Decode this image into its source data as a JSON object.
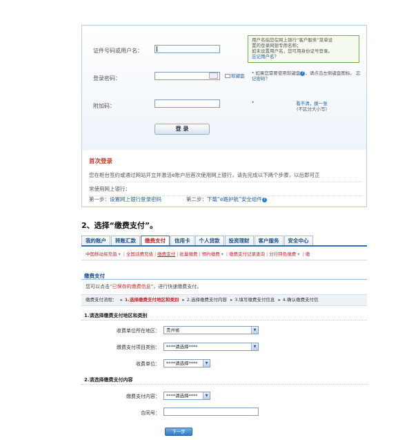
{
  "login": {
    "username_label": "证件号码或用户名：",
    "password_label": "登录密码：",
    "captcha_label": "附加码：",
    "hint_box": {
      "line1": "用户名指您在网上银行“客户服务”菜单设",
      "line2": "置的登录网银专用名称；",
      "line3": "如未设置用户名，您可用身份证号登录。",
      "link": "忘记用户名？"
    },
    "keyboard_icon": "键盘",
    "soft_keyboard_link": "软键盘",
    "soft_keyboard_hint_prefix": "* 如果您需要使用软键盘",
    "soft_keyboard_hint_mid": "，请点击左侧键盘图标。",
    "forgot_password_link": "忘记密码？",
    "captcha_star": "*",
    "captcha_refresh_line1": "看不清，换一张",
    "captcha_refresh_line2": "(不区分大小写)",
    "login_button": "登 录",
    "first_login_title": "首次登录",
    "first_login_desc_line1": "您在柜台签约或通过网站开立并激活e账户后首次使用网上银行，请先完成以下两个步骤，以后即可正",
    "first_login_desc_line2": "常使用网上银行：",
    "step1_prefix": "第一步：",
    "step1_link": "设置网上银行登录密码",
    "step2_prefix": "第二步：",
    "step2_link": "下载“e路护航”安全组件"
  },
  "step2_heading": "2、选择“缴费支付”。",
  "nav": {
    "tabs": [
      "我的账户",
      "转账汇款",
      "缴费支付",
      "信用卡",
      "个人贷款",
      "投资理财",
      "客户服务",
      "安全中心"
    ]
  },
  "subnav": {
    "items": [
      "中国移动易充值",
      "全国话费充值",
      "缴费支付",
      "批量缴费",
      "预约缴费",
      "缴费支付记录查询",
      "分行特色缴费",
      "缴"
    ]
  },
  "pay": {
    "section_title": "缴费支付",
    "intro_prefix": "您可以点击",
    "intro_quote": "“已保存的缴费信息”",
    "intro_suffix": "，进行快速缴费支付。",
    "flow_label": "缴费支付流程：",
    "flow_step1": "1.选择缴费支付地区和类别",
    "flow_step2": "2.选择缴费支付内容",
    "flow_step3": "3.填写缴费支付信息",
    "flow_step4": "4.确认缴费支付信",
    "group1_title": "1.请选择缴费支付地区和类别",
    "region_label": "收费单位所在地区：",
    "region_value": "贵州省",
    "category_label": "缴费支付项目类别：",
    "category_value": "****请选择****",
    "unit_label": "收费单位：",
    "unit_value": "****请选择****",
    "group2_title": "2.请选择缴费支付内容",
    "content_label": "缴费支付内容：",
    "content_value": "****请选择****",
    "contract_label": "合同号：",
    "contract_value": "",
    "next_button": "下一步"
  },
  "colors": {
    "accent_red": "#c62828",
    "nav_blue": "#2d6db5",
    "link_blue": "#1f5fa8",
    "hint_green": "#6fb24c"
  }
}
